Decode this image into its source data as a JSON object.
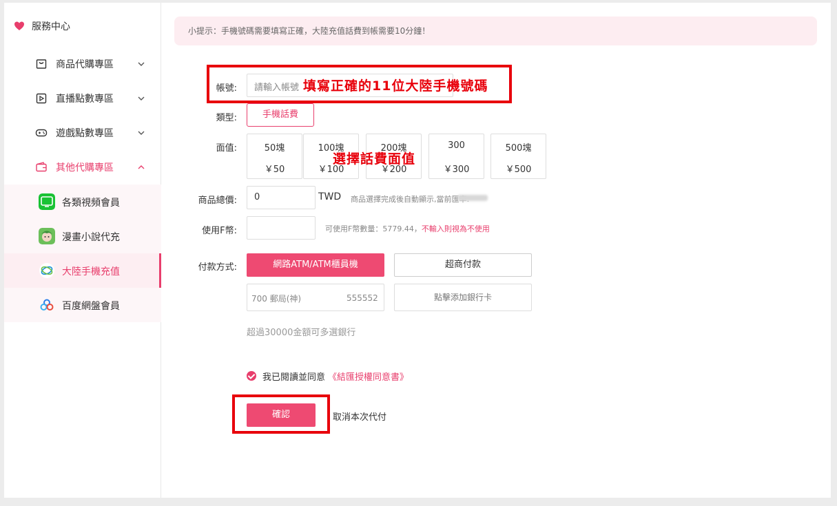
{
  "sidebar": {
    "brand": {
      "label": "服務中心",
      "icon": "heart-icon",
      "color": "#e83e6c"
    },
    "groups": [
      {
        "label": "商品代購專區",
        "icon": "bag-icon",
        "expanded": false
      },
      {
        "label": "直播點數專區",
        "icon": "play-icon",
        "expanded": false
      },
      {
        "label": "遊戲點數專區",
        "icon": "gamepad-icon",
        "expanded": false
      },
      {
        "label": "其他代購專區",
        "icon": "wallet-icon",
        "expanded": true
      }
    ],
    "sub_items": [
      {
        "label": "各類視頻會員",
        "icon": "iqiyi-icon",
        "selected": false
      },
      {
        "label": "漫畫小說代充",
        "icon": "comic-icon",
        "selected": false
      },
      {
        "label": "大陸手機充值",
        "icon": "china-mobile-icon",
        "selected": true
      },
      {
        "label": "百度網盤會員",
        "icon": "baidu-cloud-icon",
        "selected": false
      }
    ]
  },
  "tip": "小提示：手機號碼需要填寫正確，大陸充值話費到帳需要10分鐘！",
  "form": {
    "account": {
      "label": "帳號:",
      "placeholder": "請輸入帳號"
    },
    "type": {
      "label": "類型:",
      "value": "手機話費"
    },
    "face_value": {
      "label": "面值:",
      "options": [
        {
          "name": "50塊",
          "price": "￥50"
        },
        {
          "name": "100塊",
          "price": "￥100"
        },
        {
          "name": "200塊",
          "price": "￥200"
        },
        {
          "name": "300",
          "price": "￥300"
        },
        {
          "name": "500塊",
          "price": "￥500"
        }
      ]
    },
    "total": {
      "label": "商品總價:",
      "value": "0",
      "unit": "TWD",
      "hint": "商品選擇完成後自動顯示,當前匯率:"
    },
    "f_coin": {
      "label": "使用F幣:",
      "hint_prefix": "可使用F幣數量：5779.44，",
      "hint_red": "不輸入則視為不使用"
    },
    "payment": {
      "label": "付款方式:",
      "methods": [
        "網路ATM/ATM櫃員機",
        "超商付款"
      ],
      "active": 0,
      "bank": {
        "name": "700 郵局(神)",
        "account": "555552"
      },
      "add_card": "點擊添加銀行卡",
      "note": "超過30000金額可多選銀行"
    },
    "agreement": {
      "prefix": "我已閱讀並同意",
      "link": "《結匯授權同意書》",
      "checked": true
    },
    "confirm": "確認",
    "cancel": "取消本次代付"
  },
  "annotations": {
    "account_note": "填寫正確的11位大陸手機號碼",
    "face_note": "選擇話費面值",
    "color": "#e8000b"
  },
  "accent_color": "#e83e6c"
}
